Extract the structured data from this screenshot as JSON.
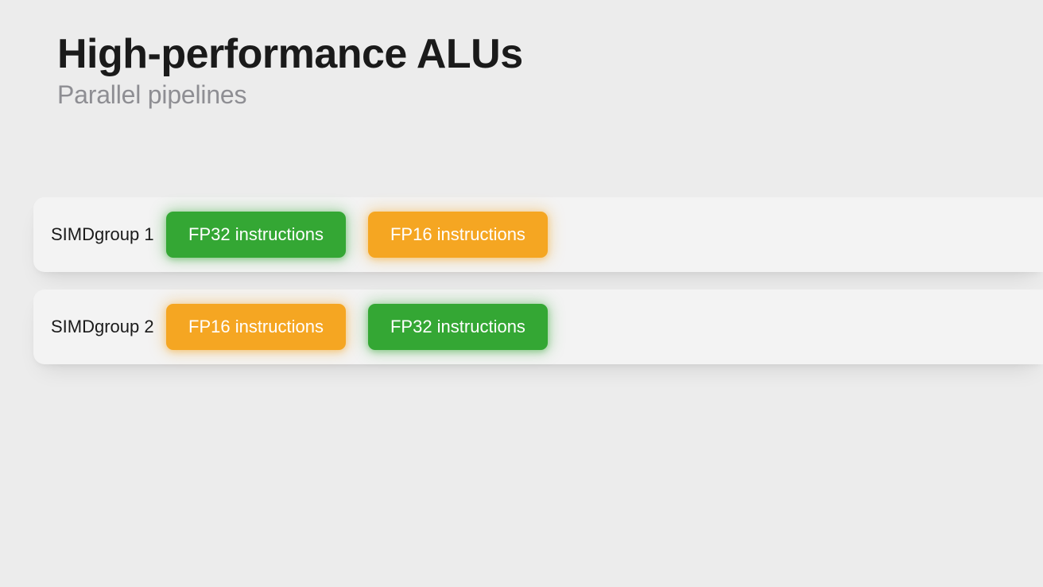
{
  "header": {
    "title": "High-performance ALUs",
    "subtitle": "Parallel pipelines"
  },
  "lanes": [
    {
      "label": "SIMDgroup 1",
      "blocks": [
        {
          "text": "FP32 instructions",
          "color": "green"
        },
        {
          "text": "FP16 instructions",
          "color": "orange"
        }
      ]
    },
    {
      "label": "SIMDgroup 2",
      "blocks": [
        {
          "text": "FP16 instructions",
          "color": "orange"
        },
        {
          "text": "FP32 instructions",
          "color": "green"
        }
      ]
    }
  ],
  "colors": {
    "green": "#34a734",
    "orange": "#f5a622",
    "background": "#ececec",
    "lane": "#f3f3f3",
    "title": "#1a1a1a",
    "subtitle": "#8e8e93"
  }
}
